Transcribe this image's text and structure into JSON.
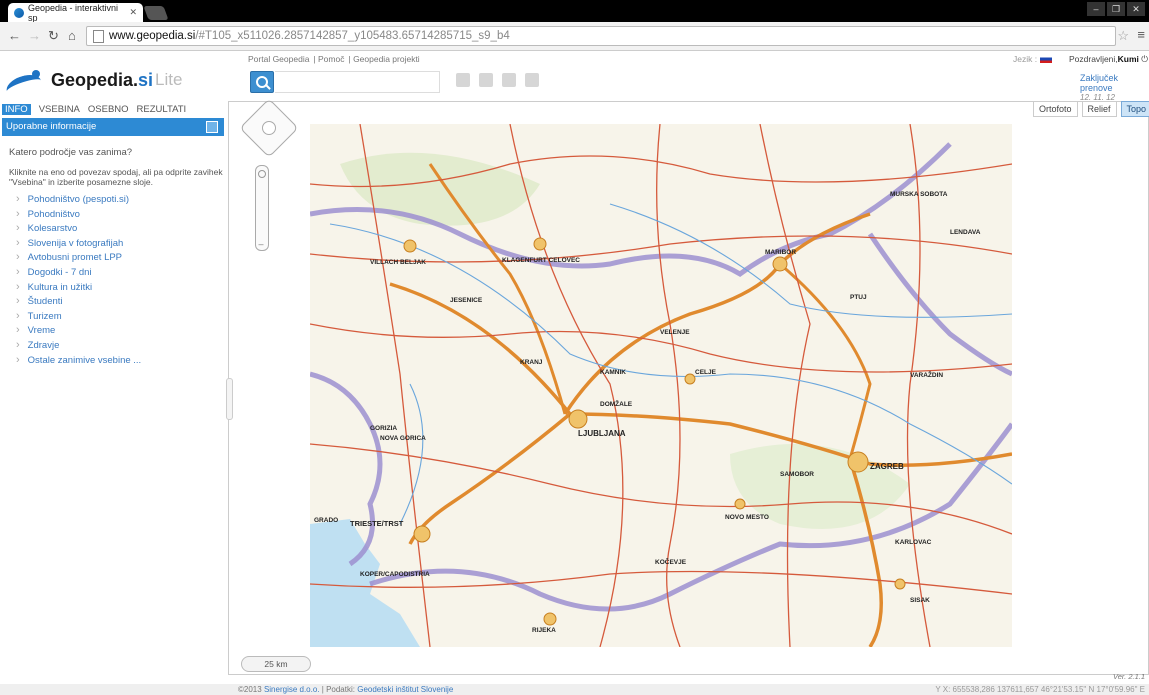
{
  "browser": {
    "tab_title": "Geopedia - interaktivni sp",
    "url_host": "www.geopedia.si",
    "url_path": "/#T105_x511026.2857142857_y105483.65714285715_s9_b4"
  },
  "header": {
    "links": [
      "Portal Geopedia",
      "Pomoč",
      "Geopedia projekti"
    ],
    "lang_label": "Jezik :",
    "greeting": "Pozdravljeni,",
    "user": "Kumi",
    "logo_name": "Geopedia.",
    "logo_si": "si",
    "logo_lite": "Lite",
    "update_label": "Zaključek prenove",
    "update_date": "12. 11. 12"
  },
  "sidebar": {
    "tabs": [
      "INFO",
      "VSEBINA",
      "OSEBNO",
      "REZULTATI"
    ],
    "panel_title": "Uporabne informacije",
    "question": "Katero področje vas zanima?",
    "intro": "Kliknite na eno od povezav spodaj, ali pa odprite zavihek \"Vsebina\" in izberite posamezne sloje.",
    "links": [
      "Pohodništvo (pespoti.si)",
      "Pohodništvo",
      "Kolesarstvo",
      "Slovenija v fotografijah",
      "Avtobusni promet LPP",
      "Dogodki - 7 dni",
      "Kultura in užitki",
      "Študenti",
      "Turizem",
      "Vreme",
      "Zdravje",
      "Ostale zanimive vsebine ..."
    ]
  },
  "map": {
    "layers": [
      "Ortofoto",
      "Relief",
      "Topo"
    ],
    "active_layer": "Topo",
    "scale": "25 km",
    "version": "Ver. 2.1.1",
    "places": [
      "KLAGENFURT CELOVEC",
      "VILLACH BELJAK",
      "JESENICE",
      "KRANJ",
      "LJUBLJANA",
      "CELJE",
      "MARIBOR",
      "PTUJ",
      "NOVO MESTO",
      "ZAGREB",
      "KARLOVAC",
      "TRIESTE/TRST",
      "KOPER/CAPODISTRIA",
      "GORIZIA",
      "NOVA GORICA",
      "SAMOBOR",
      "VARAŽDIN",
      "RIJEKA",
      "LENDAVA",
      "SISAK",
      "VELENJE",
      "KAMNIK",
      "MURSKA SOBOTA",
      "GRADO",
      "DOMŽALE",
      "KOČEVJE"
    ]
  },
  "footer": {
    "copyright": "©2013",
    "company": "Sinergise d.o.o.",
    "data_label": "| Podatki:",
    "data_source": "Geodetski inštitut Slovenije",
    "coords": "Y X: 655538,286 137611,657   46°21'53.15\" N 17°0'59.96\" E"
  },
  "colors": {
    "accent": "#2d8ad4",
    "link": "#3a7ac0"
  }
}
